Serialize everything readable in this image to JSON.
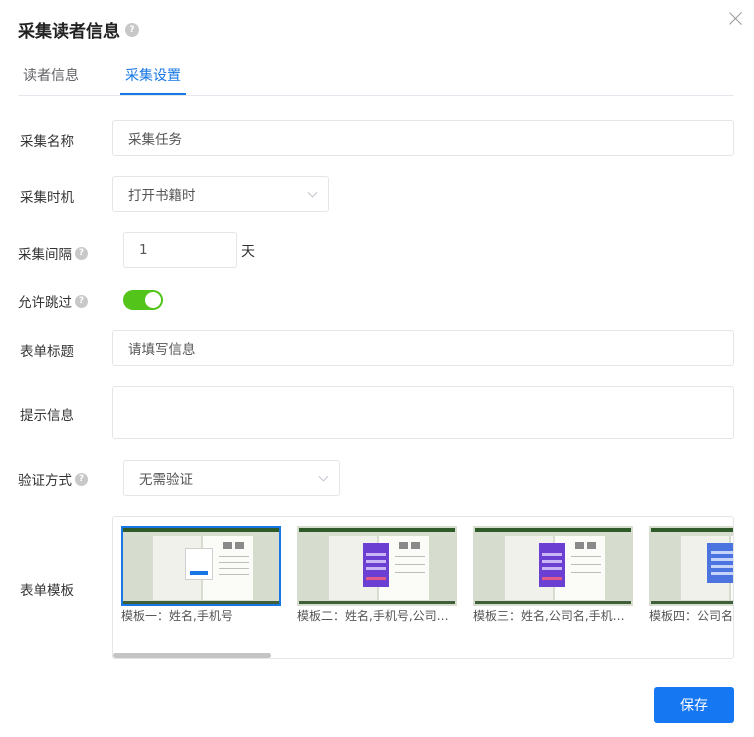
{
  "dialog": {
    "title": "采集读者信息",
    "help_icon": "question-circle-icon"
  },
  "tabs": [
    {
      "label": "读者信息",
      "active": false
    },
    {
      "label": "采集设置",
      "active": true
    }
  ],
  "form": {
    "name": {
      "label": "采集名称",
      "value": "采集任务"
    },
    "timing": {
      "label": "采集时机",
      "value": "打开书籍时"
    },
    "interval": {
      "label": "采集间隔",
      "value": "1",
      "unit": "天"
    },
    "allow_skip": {
      "label": "允许跳过",
      "enabled": true
    },
    "form_title": {
      "label": "表单标题",
      "value": "请填写信息"
    },
    "hint": {
      "label": "提示信息",
      "value": ""
    },
    "verify": {
      "label": "验证方式",
      "value": "无需验证"
    },
    "template": {
      "label": "表单模板",
      "items": [
        {
          "caption": "模板一：姓名,手机号",
          "selected": true
        },
        {
          "caption": "模板二：姓名,手机号,公司名...",
          "selected": false
        },
        {
          "caption": "模板三：姓名,公司名,手机号...",
          "selected": false
        },
        {
          "caption": "模板四：公司名",
          "selected": false
        }
      ]
    }
  },
  "save_label": "保存",
  "colors": {
    "accent": "#1677e5",
    "switch_on": "#52c41a",
    "template_purple": "#6a3fd1",
    "template_blue": "#4c74e0"
  }
}
